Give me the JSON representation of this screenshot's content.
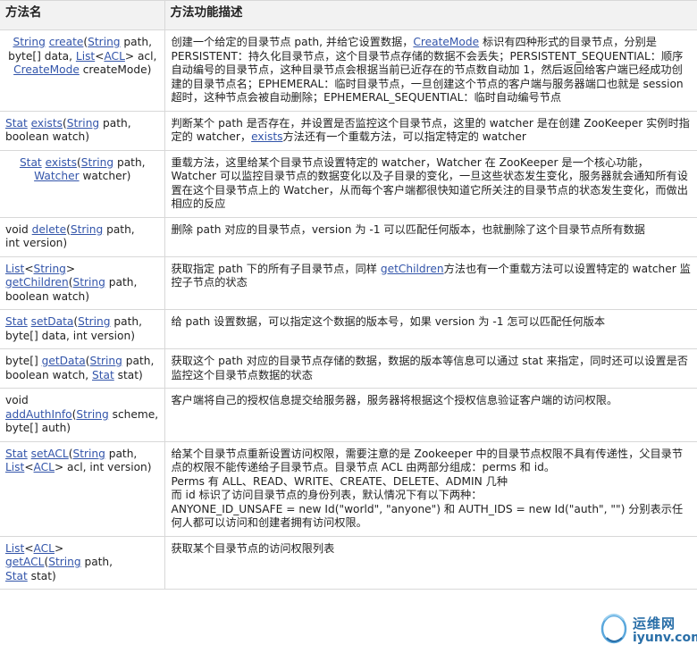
{
  "headers": {
    "method": "方法名",
    "desc": "方法功能描述"
  },
  "rows": [
    {
      "method": [
        [
          "String",
          "l"
        ],
        [
          " ",
          ""
        ],
        [
          "create",
          "l"
        ],
        [
          "(",
          ""
        ],
        [
          "String",
          "l"
        ],
        [
          " path,\nbyte[] data, ",
          ""
        ],
        [
          "List",
          "l"
        ],
        [
          "<",
          ""
        ],
        [
          "ACL",
          "l"
        ],
        [
          "> acl,\n",
          ""
        ],
        [
          "CreateMode",
          "l"
        ],
        [
          " createMode)",
          ""
        ]
      ],
      "align": "center",
      "desc": [
        [
          "创建一个给定的目录节点 path, 并给它设置数据，",
          ""
        ],
        [
          "CreateMode",
          "l"
        ],
        [
          " 标识有四种形式的目录节点，分别是 PERSISTENT：持久化目录节点，这个目录节点存储的数据不会丢失；PERSISTENT_SEQUENTIAL：顺序自动编号的目录节点，这种目录节点会根据当前已近存在的节点数自动加 1，然后返回给客户端已经成功创建的目录节点名；EPHEMERAL：临时目录节点，一旦创建这个节点的客户端与服务器端口也就是 session 超时，这种节点会被自动删除；EPHEMERAL_SEQUENTIAL：临时自动编号节点",
          ""
        ]
      ]
    },
    {
      "method": [
        [
          "Stat",
          "l"
        ],
        [
          " ",
          ""
        ],
        [
          "exists",
          "l"
        ],
        [
          "(",
          ""
        ],
        [
          "String",
          "l"
        ],
        [
          " path,\nboolean watch)",
          ""
        ]
      ],
      "align": "left",
      "desc": [
        [
          "判断某个 path 是否存在，并设置是否监控这个目录节点，这里的 watcher 是在创建 ZooKeeper 实例时指定的 watcher，",
          ""
        ],
        [
          "exists",
          "l"
        ],
        [
          "方法还有一个重载方法，可以指定特定的 watcher",
          ""
        ]
      ]
    },
    {
      "method": [
        [
          "Stat",
          "l"
        ],
        [
          " ",
          ""
        ],
        [
          "exists",
          "l"
        ],
        [
          "(",
          ""
        ],
        [
          "String",
          "l"
        ],
        [
          " path,\n",
          ""
        ],
        [
          "Watcher",
          "l"
        ],
        [
          " watcher)",
          ""
        ]
      ],
      "align": "center",
      "desc": [
        [
          "重载方法，这里给某个目录节点设置特定的 watcher，Watcher 在 ZooKeeper 是一个核心功能，Watcher 可以监控目录节点的数据变化以及子目录的变化，一旦这些状态发生变化，服务器就会通知所有设置在这个目录节点上的 Watcher，从而每个客户端都很快知道它所关注的目录节点的状态发生变化，而做出相应的反应",
          ""
        ]
      ]
    },
    {
      "method": [
        [
          "void ",
          ""
        ],
        [
          "delete",
          "l"
        ],
        [
          "(",
          ""
        ],
        [
          "String",
          "l"
        ],
        [
          " path,\nint version)",
          ""
        ]
      ],
      "align": "left",
      "desc": [
        [
          "删除 path 对应的目录节点，version 为 -1 可以匹配任何版本，也就删除了这个目录节点所有数据",
          ""
        ]
      ]
    },
    {
      "method": [
        [
          "List",
          "l"
        ],
        [
          "<",
          ""
        ],
        [
          "String",
          "l"
        ],
        [
          ">\n",
          ""
        ],
        [
          "getChildren",
          "l"
        ],
        [
          "(",
          ""
        ],
        [
          "String",
          "l"
        ],
        [
          " path,\nboolean watch)",
          ""
        ]
      ],
      "align": "left",
      "desc": [
        [
          "获取指定 path 下的所有子目录节点，同样 ",
          ""
        ],
        [
          "getChildren",
          "l"
        ],
        [
          "方法也有一个重载方法可以设置特定的 watcher 监控子节点的状态",
          ""
        ]
      ]
    },
    {
      "method": [
        [
          "Stat",
          "l"
        ],
        [
          " ",
          ""
        ],
        [
          "setData",
          "l"
        ],
        [
          "(",
          ""
        ],
        [
          "String",
          "l"
        ],
        [
          " path,\nbyte[] data, int version)",
          ""
        ]
      ],
      "align": "left",
      "desc": [
        [
          "给 path 设置数据，可以指定这个数据的版本号，如果 version 为 -1 怎可以匹配任何版本",
          ""
        ]
      ]
    },
    {
      "method": [
        [
          "byte[] ",
          ""
        ],
        [
          "getData",
          "l"
        ],
        [
          "(",
          ""
        ],
        [
          "String",
          "l"
        ],
        [
          " path,\nboolean watch, ",
          ""
        ],
        [
          "Stat",
          "l"
        ],
        [
          " stat)",
          ""
        ]
      ],
      "align": "left",
      "desc": [
        [
          "获取这个 path 对应的目录节点存储的数据，数据的版本等信息可以通过 stat 来指定，同时还可以设置是否监控这个目录节点数据的状态",
          ""
        ]
      ]
    },
    {
      "method": [
        [
          "void\n",
          ""
        ],
        [
          "addAuthInfo",
          "l"
        ],
        [
          "(",
          ""
        ],
        [
          "String",
          "l"
        ],
        [
          " scheme,\nbyte[] auth)",
          ""
        ]
      ],
      "align": "left",
      "desc": [
        [
          "客户端将自己的授权信息提交给服务器，服务器将根据这个授权信息验证客户端的访问权限。",
          ""
        ]
      ]
    },
    {
      "method": [
        [
          "Stat",
          "l"
        ],
        [
          " ",
          ""
        ],
        [
          "setACL",
          "l"
        ],
        [
          "(",
          ""
        ],
        [
          "String",
          "l"
        ],
        [
          " path,\n",
          ""
        ],
        [
          "List",
          "l"
        ],
        [
          "<",
          ""
        ],
        [
          "ACL",
          "l"
        ],
        [
          "> acl, int version)",
          ""
        ]
      ],
      "align": "left",
      "desc": [
        [
          "给某个目录节点重新设置访问权限，需要注意的是 Zookeeper 中的目录节点权限不具有传递性，父目录节点的权限不能传递给子目录节点。目录节点 ACL 由两部分组成：perms 和 id。\nPerms 有 ALL、READ、WRITE、CREATE、DELETE、ADMIN 几种\n而 id 标识了访问目录节点的身份列表，默认情况下有以下两种：\nANYONE_ID_UNSAFE = new Id(\"world\", \"anyone\") 和 AUTH_IDS = new Id(\"auth\", \"\") 分别表示任何人都可以访问和创建者拥有访问权限。",
          ""
        ]
      ]
    },
    {
      "method": [
        [
          "List",
          "l"
        ],
        [
          "<",
          ""
        ],
        [
          "ACL",
          "l"
        ],
        [
          ">\n",
          ""
        ],
        [
          "getACL",
          "l"
        ],
        [
          "(",
          ""
        ],
        [
          "String",
          "l"
        ],
        [
          " path,\n",
          ""
        ],
        [
          "Stat",
          "l"
        ],
        [
          " stat)",
          ""
        ]
      ],
      "align": "left",
      "desc": [
        [
          "获取某个目录节点的访问权限列表",
          ""
        ]
      ]
    }
  ],
  "watermark": {
    "cn": "运维网",
    "en": "iyunv.com",
    "icon": "brand-ring-logo"
  },
  "colors": {
    "link": "#3355aa",
    "header_bg": "#f2f2f2",
    "border": "#d8d8d8"
  }
}
